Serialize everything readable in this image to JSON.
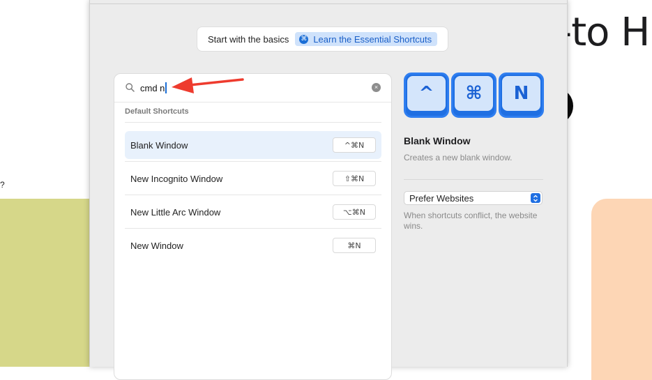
{
  "background": {
    "heading_fragment": "-to Hu",
    "side_fragment": "?"
  },
  "basics_bar": {
    "text": "Start with the basics",
    "learn_button_label": "Learn the Essential Shortcuts",
    "learn_icon": "⌘"
  },
  "search": {
    "value": "cmd n",
    "clear_icon": "×"
  },
  "section_label": "Default Shortcuts",
  "shortcuts": [
    {
      "label": "Blank Window",
      "keys": "^⌘N",
      "selected": true
    },
    {
      "label": "New Incognito Window",
      "keys": "⇧⌘N",
      "selected": false
    },
    {
      "label": "New Little Arc Window",
      "keys": "⌥⌘N",
      "selected": false
    },
    {
      "label": "New Window",
      "keys": "⌘N",
      "selected": false
    }
  ],
  "keycaps": [
    "^",
    "⌘",
    "N"
  ],
  "detail": {
    "title": "Blank Window",
    "description": "Creates a new blank window."
  },
  "conflict": {
    "selected_option": "Prefer Websites",
    "note": "When shortcuts conflict, the website wins."
  },
  "colors": {
    "accent": "#1f6fe2",
    "selected_row": "#e8f1fc",
    "annotation_arrow": "#ee3b2e"
  }
}
